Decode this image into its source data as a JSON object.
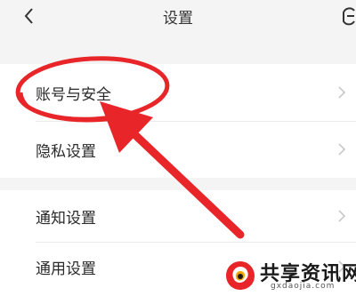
{
  "header": {
    "title": "设置",
    "back_icon": "chevron-left-icon",
    "right_icon": "more-icon"
  },
  "settings": {
    "group1": [
      {
        "label": "账号与安全"
      },
      {
        "label": "隐私设置"
      }
    ],
    "group2": [
      {
        "label": "通知设置"
      },
      {
        "label": "通用设置"
      }
    ]
  },
  "annotation": {
    "color": "#e8262a",
    "shapes": [
      "circle-highlight",
      "arrow"
    ]
  },
  "watermark": {
    "name": "共享资讯网",
    "url": "gxdaojia.com",
    "logo_colors": [
      "#e8262a",
      "#f2a400",
      "#1a1a1a"
    ]
  }
}
